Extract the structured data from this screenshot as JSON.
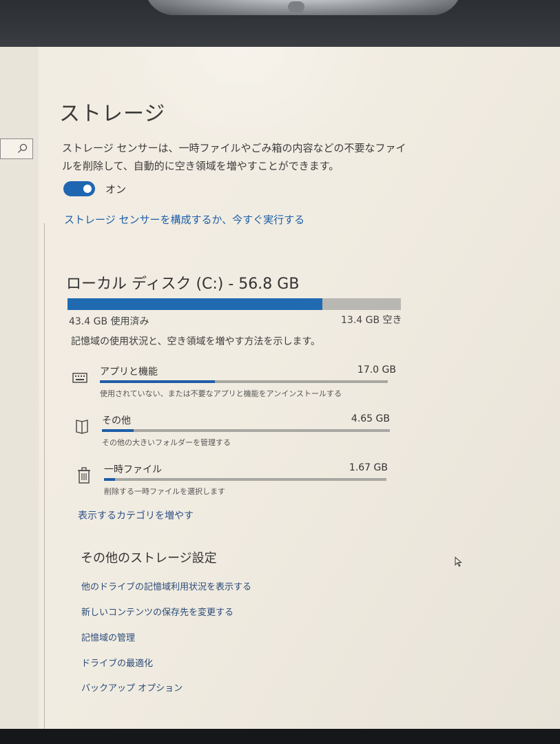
{
  "page": {
    "title": "ストレージ",
    "storage_sense_description": "ストレージ センサーは、一時ファイルやごみ箱の内容などの不要なファイルを削除して、自動的に空き領域を増やすことができます。",
    "toggle_state_label": "オン",
    "toggle_on": true,
    "configure_link": "ストレージ センサーを構成するか、今すぐ実行する"
  },
  "disk": {
    "title": "ローカル ディスク (C:) - 56.8 GB",
    "used_label": "43.4 GB 使用済み",
    "free_label": "13.4 GB 空き",
    "used_fraction": 0.764,
    "description": "記憶域の使用状況と、空き領域を増やす方法を示します。"
  },
  "categories": [
    {
      "name": "アプリと機能",
      "size": "17.0 GB",
      "hint": "使用されていない、または不要なアプリと機能をアンインストールする",
      "icon": "keyboard-icon",
      "fraction": 0.4
    },
    {
      "name": "その他",
      "size": "4.65 GB",
      "hint": "その他の大きいフォルダーを管理する",
      "icon": "folder-icon",
      "fraction": 0.11
    },
    {
      "name": "一時ファイル",
      "size": "1.67 GB",
      "hint": "削除する一時ファイルを選択します",
      "icon": "trash-icon",
      "fraction": 0.04
    }
  ],
  "more_categories_link": "表示するカテゴリを増やす",
  "other_settings": {
    "title": "その他のストレージ設定",
    "links": [
      "他のドライブの記憶域利用状況を表示する",
      "新しいコンテンツの保存先を変更する",
      "記憶域の管理",
      "ドライブの最適化",
      "バックアップ オプション"
    ]
  },
  "colors": {
    "accent": "#1f66b2",
    "link": "#1d5fa8",
    "bar_track": "#b9b7b2"
  }
}
